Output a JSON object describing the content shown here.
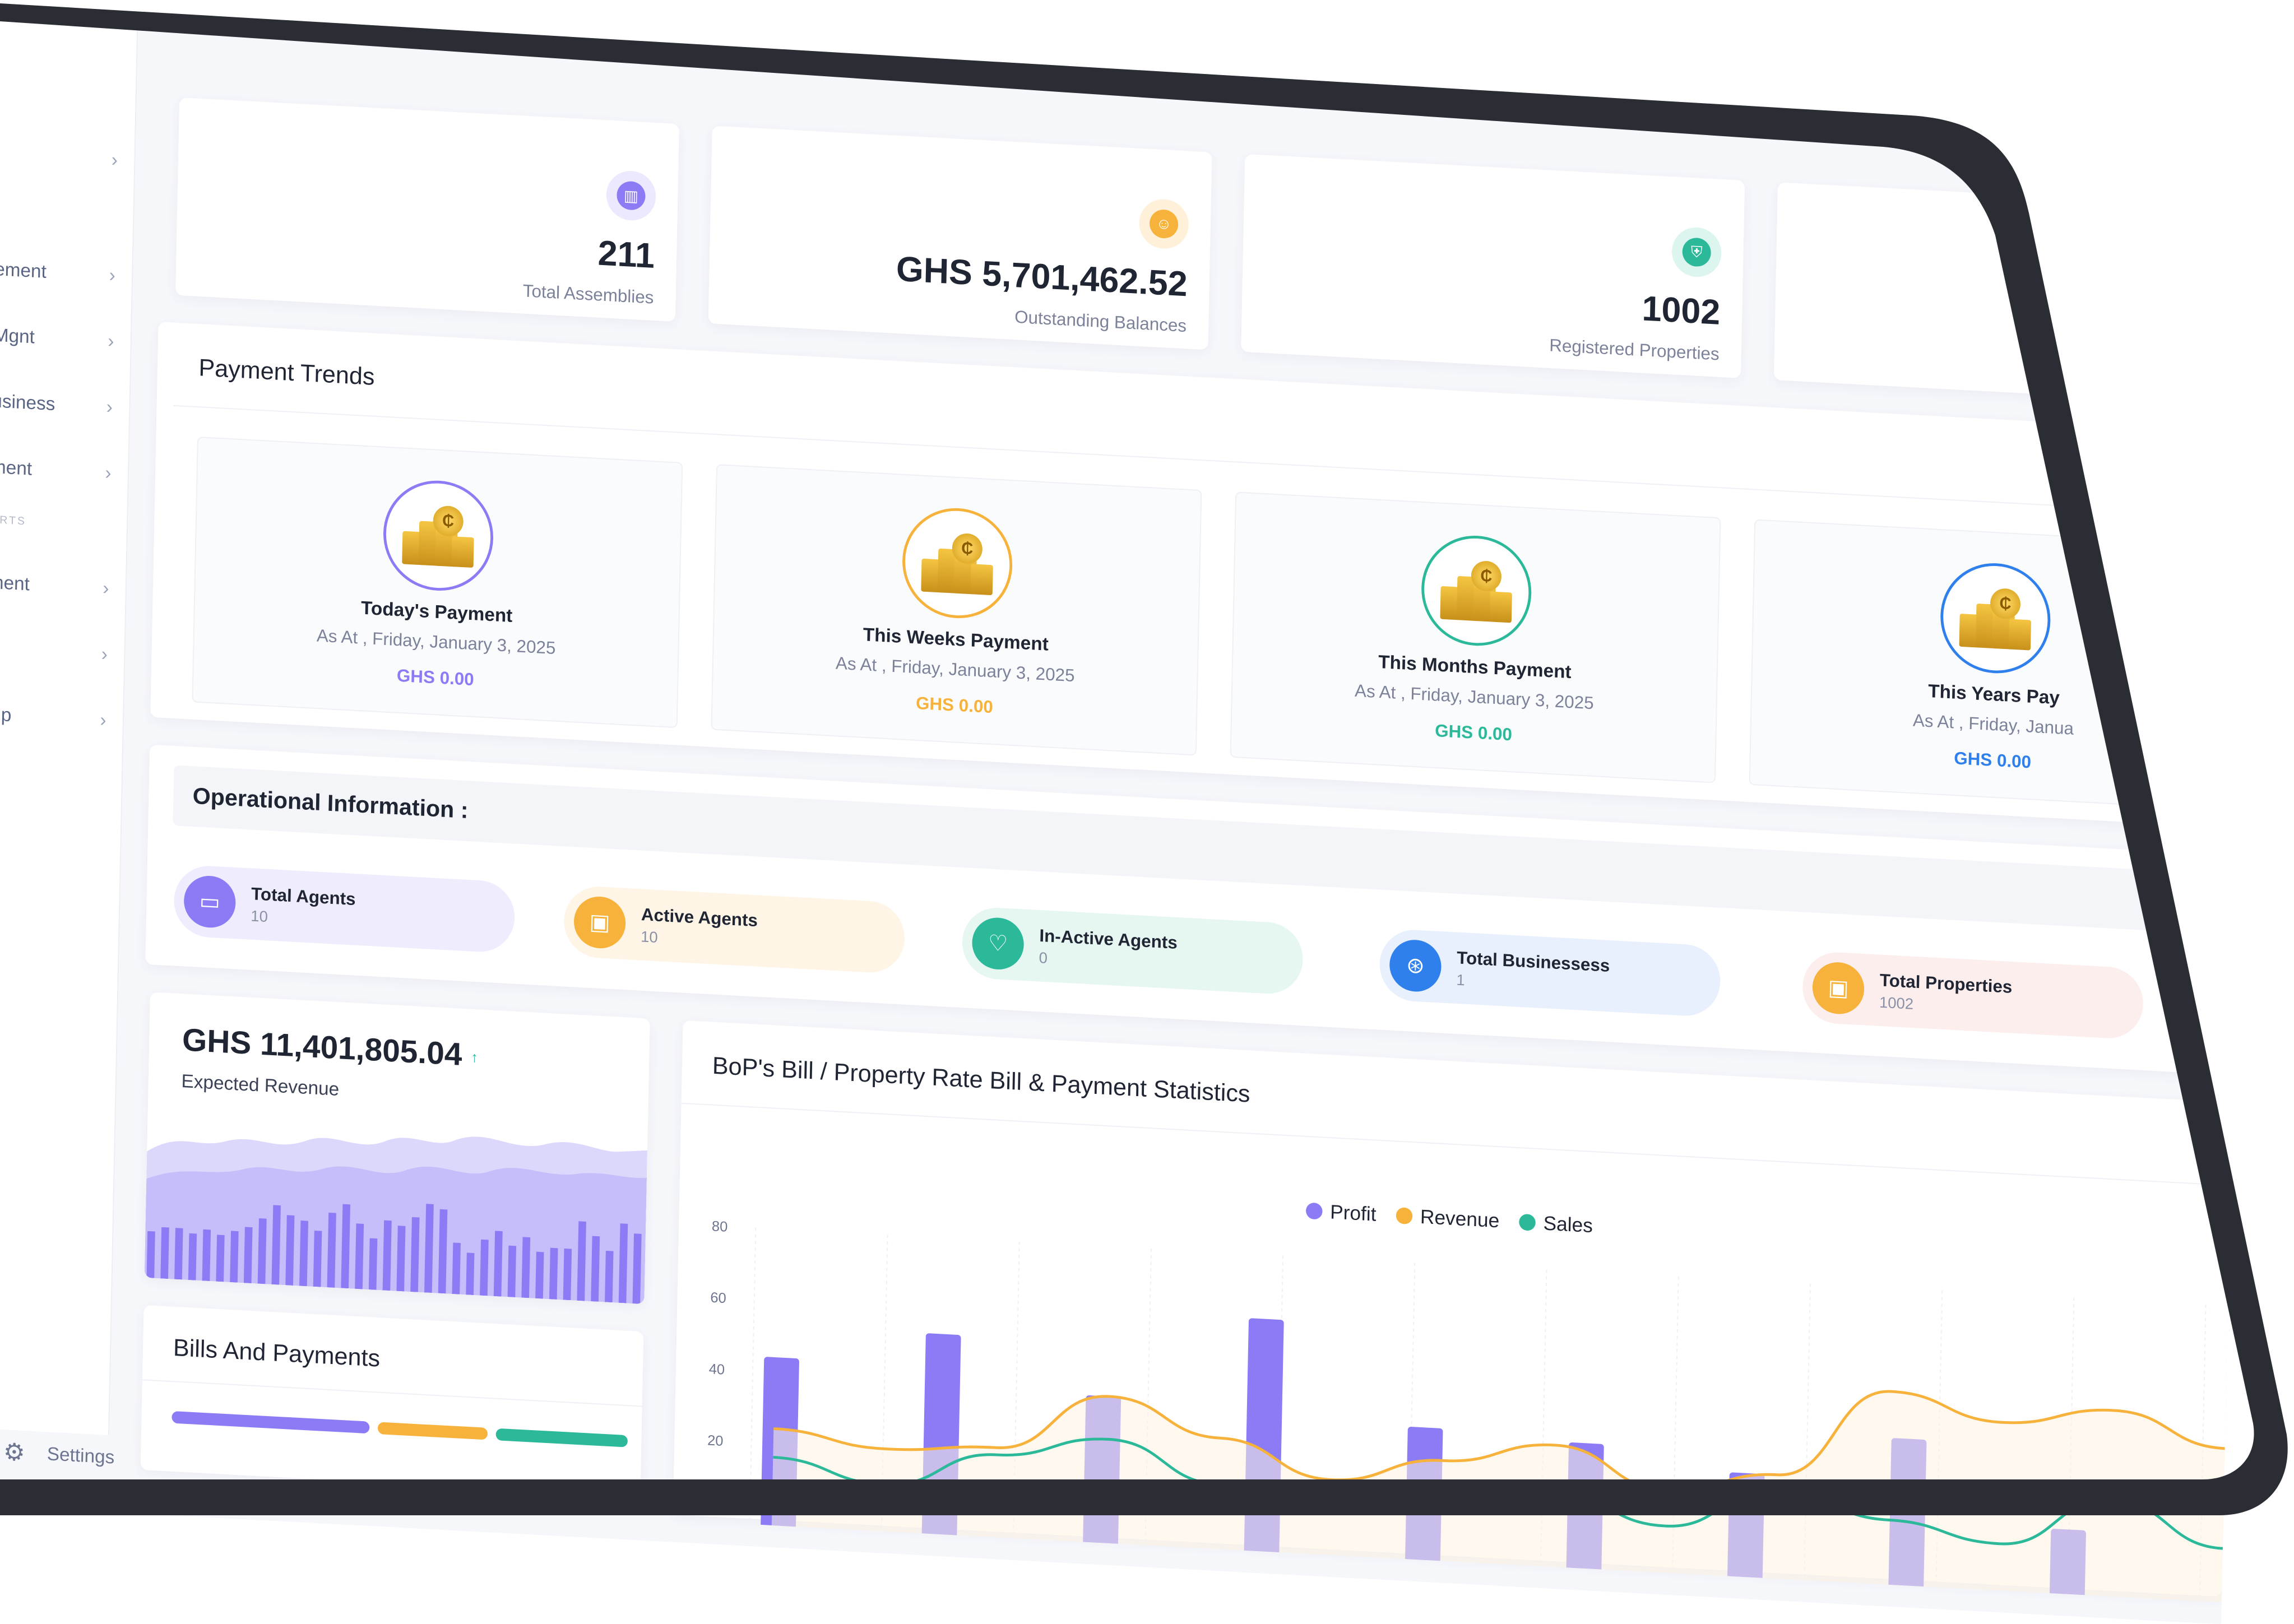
{
  "sidebar": {
    "items": [
      {
        "label": ""
      },
      {
        "label": "ement"
      },
      {
        "label": "Mgnt"
      },
      {
        "label": "usiness"
      },
      {
        "label": "ment"
      },
      {
        "label": "ment"
      },
      {
        "label": ""
      },
      {
        "label": "tup"
      }
    ],
    "section_label": "ORTS",
    "settings_label": "Settings",
    "chevron": "›"
  },
  "stats": [
    {
      "value": "211",
      "label": "Total Assemblies",
      "icon": "chart-icon",
      "color": "#8b7cf6",
      "bg": "#ece9fe"
    },
    {
      "value": "GHS 5,701,462.52",
      "label": "Outstanding Balances",
      "icon": "user-icon",
      "color": "#f7b23b",
      "bg": "#fff1d9"
    },
    {
      "value": "1002",
      "label": "Registered Properties",
      "icon": "handshake-icon",
      "color": "#2bb99a",
      "bg": "#dcf5ee"
    }
  ],
  "payment_trends": {
    "title": "Payment Trends",
    "cards": [
      {
        "title": "Today's Payment",
        "date": "As At , Friday, January 3, 2025",
        "amount": "GHS 0.00",
        "color": "#8b7cf6"
      },
      {
        "title": "This Weeks Payment",
        "date": "As At , Friday, January 3, 2025",
        "amount": "GHS 0.00",
        "color": "#f7b23b"
      },
      {
        "title": "This Months Payment",
        "date": "As At , Friday, January 3, 2025",
        "amount": "GHS 0.00",
        "color": "#2bb99a"
      },
      {
        "title": "This Years Pay",
        "date": "As At , Friday, Janua",
        "amount": "GHS 0.00",
        "color": "#2f80ed"
      }
    ]
  },
  "operational": {
    "title": "Operational Information :",
    "pills": [
      {
        "label": "Total Agents",
        "value": "10",
        "icon": "laptop-icon",
        "color": "#8b7cf6",
        "bg": "#efedfd"
      },
      {
        "label": "Active Agents",
        "value": "10",
        "icon": "briefcase-icon",
        "color": "#f7b23b",
        "bg": "#fff5e6"
      },
      {
        "label": "In-Active Agents",
        "value": "0",
        "icon": "heart-icon",
        "color": "#2bb99a",
        "bg": "#e6f6f1"
      },
      {
        "label": "Total Businessess",
        "value": "1",
        "icon": "globe-icon",
        "color": "#2f80ed",
        "bg": "#e8f0fd"
      },
      {
        "label": "Total Properties",
        "value": "1002",
        "icon": "briefcase-icon",
        "color": "#f7b23b",
        "bg": "#fdeeee"
      }
    ]
  },
  "revenue": {
    "value": "GHS 11,401,805.04",
    "arrow": "↑",
    "label": "Expected Revenue",
    "bars": [
      0.5,
      0.55,
      0.55,
      0.5,
      0.55,
      0.5,
      0.55,
      0.6,
      0.7,
      0.85,
      0.75,
      0.7,
      0.6,
      0.8,
      0.9,
      0.7,
      0.55,
      0.75,
      0.7,
      0.8,
      0.95,
      0.9,
      0.55,
      0.45,
      0.6,
      0.7,
      0.55,
      0.65,
      0.5,
      0.55,
      0.55,
      0.85,
      0.7,
      0.55,
      0.85,
      0.75
    ]
  },
  "bills": {
    "title": "Bills And Payments",
    "colors": [
      "#8b7cf6",
      "#f7b23b",
      "#2bb99a"
    ]
  },
  "chart_data": {
    "type": "bar",
    "title": "BoP's Bill / Property Rate Bill & Payment Statistics",
    "legend_position": "top-center",
    "yticks": [
      "80",
      "60",
      "40",
      "20"
    ],
    "ylim": [
      0,
      80
    ],
    "series": [
      {
        "name": "Profit",
        "color": "#8b7cf6",
        "values": [
          44,
          53,
          38,
          62,
          34,
          32,
          26,
          38,
          15
        ]
      },
      {
        "name": "Revenue",
        "color": "#f7b23b",
        "values": [
          24,
          20,
          22,
          38,
          28,
          18,
          25,
          31,
          20,
          26,
          51,
          44,
          49,
          40
        ]
      },
      {
        "name": "Sales",
        "color": "#2bb99a",
        "values": [
          16,
          10,
          20,
          26,
          15,
          10,
          12,
          18,
          10,
          22,
          15,
          10,
          24,
          12
        ]
      }
    ]
  }
}
